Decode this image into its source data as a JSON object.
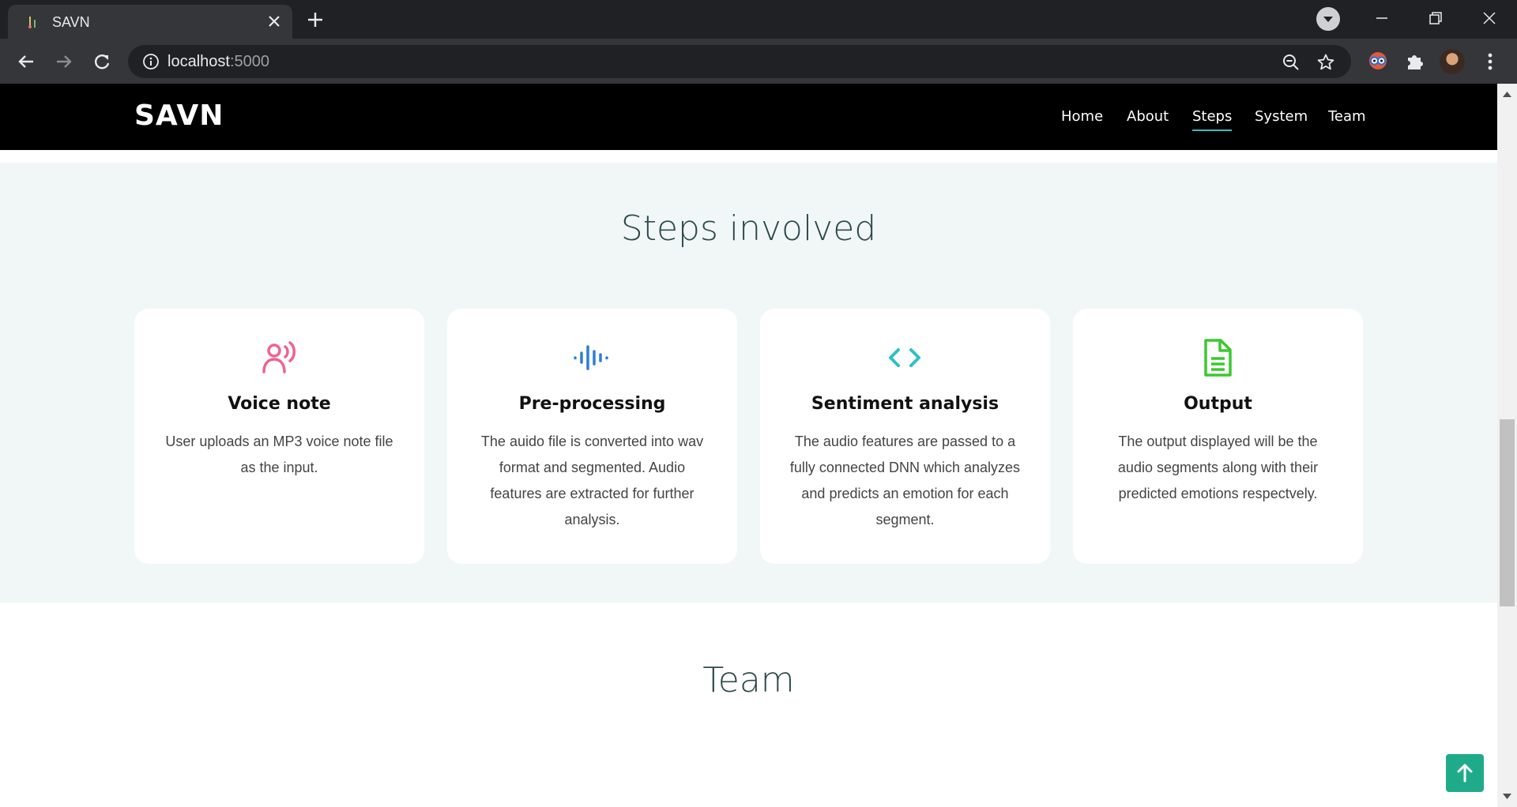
{
  "browser": {
    "tab_title": "SAVN",
    "url_host": "localhost",
    "url_port": ":5000"
  },
  "site": {
    "logo": "SAVN",
    "nav": [
      {
        "label": "Home"
      },
      {
        "label": "About"
      },
      {
        "label": "Steps",
        "active": true
      },
      {
        "label": "System"
      },
      {
        "label": "Team"
      }
    ]
  },
  "steps": {
    "title": "Steps involved",
    "cards": [
      {
        "icon": "person-voice-icon",
        "color": "#f06292",
        "title": "Voice note",
        "text": "User uploads an MP3 voice note file as the input."
      },
      {
        "icon": "soundwave-icon",
        "color": "#2e7dd7",
        "title": "Pre-processing",
        "text": "The auido file is converted into wav format and segmented. Audio features are extracted for further analysis."
      },
      {
        "icon": "code-brackets-icon",
        "color": "#2fc1c4",
        "title": "Sentiment analysis",
        "text": "The audio features are passed to a fully connected DNN which analyzes and predicts an emotion for each segment."
      },
      {
        "icon": "document-icon",
        "color": "#3cc82f",
        "title": "Output",
        "text": "The output displayed will be the audio segments along with their predicted emotions respectvely."
      }
    ]
  },
  "team": {
    "title": "Team"
  },
  "colors": {
    "accent": "#3fbbc0",
    "back_to_top": "#1fab89",
    "section_bg": "#f1f7f7"
  }
}
